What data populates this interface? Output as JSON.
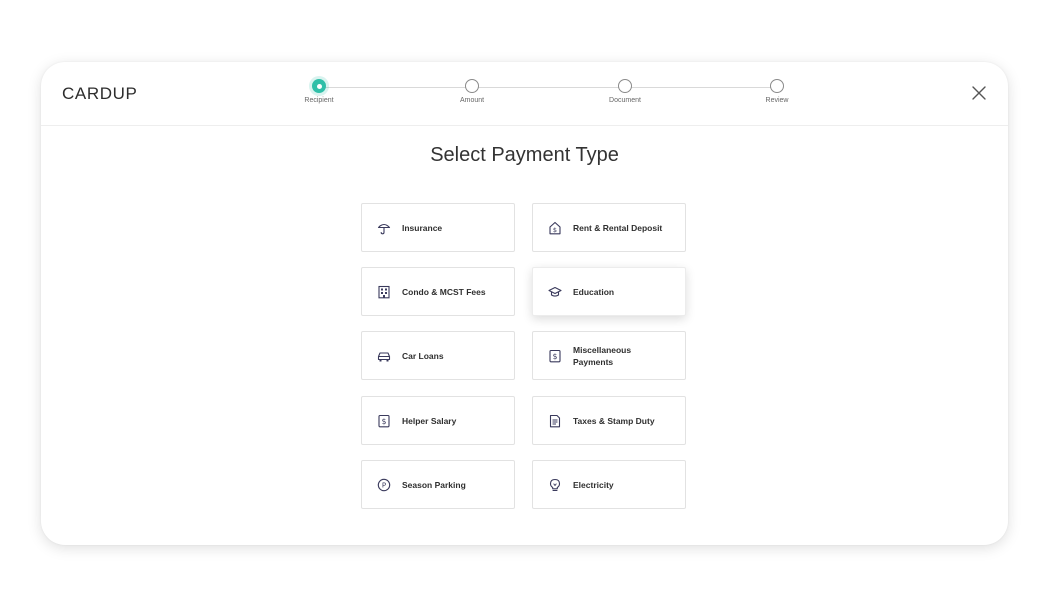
{
  "app": {
    "logo": "CARDUP"
  },
  "stepper": {
    "steps": [
      {
        "label": "Recipient",
        "active": true
      },
      {
        "label": "Amount",
        "active": false
      },
      {
        "label": "Document",
        "active": false
      },
      {
        "label": "Review",
        "active": false
      }
    ]
  },
  "page": {
    "title": "Select Payment Type"
  },
  "payment_types": [
    {
      "label": "Insurance",
      "icon": "umbrella-icon"
    },
    {
      "label": "Rent & Rental Deposit",
      "icon": "house-dollar-icon"
    },
    {
      "label": "Condo & MCST Fees",
      "icon": "building-icon"
    },
    {
      "label": "Education",
      "icon": "graduation-cap-icon",
      "selected": true
    },
    {
      "label": "Car Loans",
      "icon": "car-icon"
    },
    {
      "label": "Miscellaneous Payments",
      "icon": "dollar-bill-icon"
    },
    {
      "label": "Helper Salary",
      "icon": "salary-dollar-icon"
    },
    {
      "label": "Taxes & Stamp Duty",
      "icon": "document-icon"
    },
    {
      "label": "Season Parking",
      "icon": "parking-icon"
    },
    {
      "label": "Electricity",
      "icon": "lightbulb-icon"
    }
  ],
  "colors": {
    "accent": "#2fbfa8",
    "icon": "#3a3a5c"
  }
}
